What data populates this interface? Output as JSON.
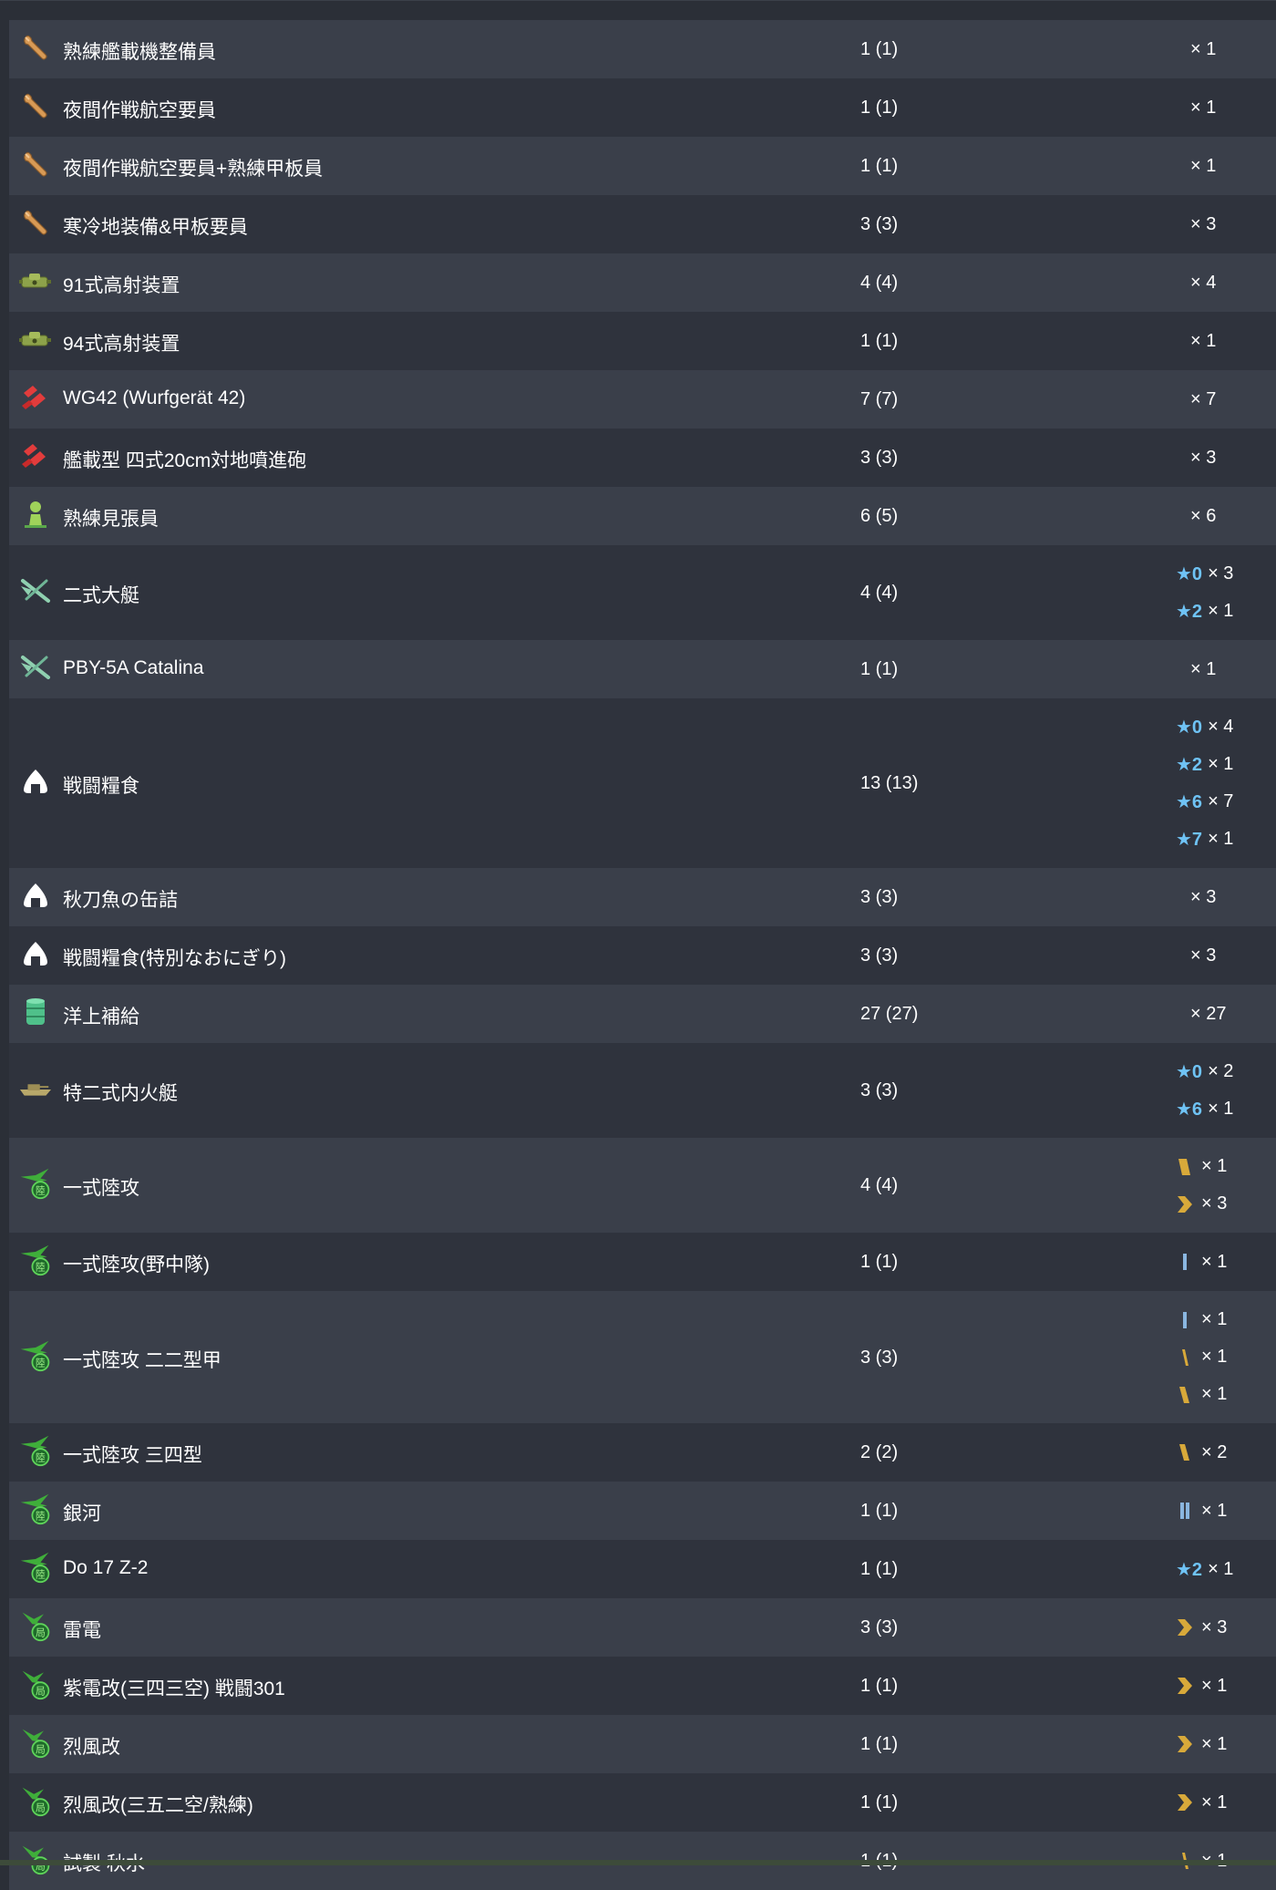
{
  "colors": {
    "star": "#6fc3f5",
    "row_a": "#3a3f4a",
    "row_b": "#2f333d"
  },
  "rows": [
    {
      "icon": "wrench-icon",
      "name": "熟練艦載機整備員",
      "count": "1 (1)",
      "levels": [
        {
          "kind": "plain",
          "mult": "× 1"
        }
      ]
    },
    {
      "icon": "wrench-icon",
      "name": "夜間作戦航空要員",
      "count": "1 (1)",
      "levels": [
        {
          "kind": "plain",
          "mult": "× 1"
        }
      ]
    },
    {
      "icon": "wrench-icon",
      "name": "夜間作戦航空要員+熟練甲板員",
      "count": "1 (1)",
      "levels": [
        {
          "kind": "plain",
          "mult": "× 1"
        }
      ]
    },
    {
      "icon": "wrench-icon",
      "name": "寒冷地装備&甲板要員",
      "count": "3 (3)",
      "levels": [
        {
          "kind": "plain",
          "mult": "× 3"
        }
      ]
    },
    {
      "icon": "aa-fire-director-icon",
      "name": "91式高射装置",
      "count": "4 (4)",
      "levels": [
        {
          "kind": "plain",
          "mult": "× 4"
        }
      ]
    },
    {
      "icon": "aa-fire-director-icon",
      "name": "94式高射装置",
      "count": "1 (1)",
      "levels": [
        {
          "kind": "plain",
          "mult": "× 1"
        }
      ]
    },
    {
      "icon": "rocket-icon",
      "name": "WG42 (Wurfgerät 42)",
      "count": "7 (7)",
      "levels": [
        {
          "kind": "plain",
          "mult": "× 7"
        }
      ]
    },
    {
      "icon": "rocket-icon",
      "name": "艦載型 四式20cm対地噴進砲",
      "count": "3 (3)",
      "levels": [
        {
          "kind": "plain",
          "mult": "× 3"
        }
      ]
    },
    {
      "icon": "lookout-icon",
      "name": "熟練見張員",
      "count": "6 (5)",
      "levels": [
        {
          "kind": "plain",
          "mult": "× 6"
        }
      ]
    },
    {
      "icon": "flying-boat-icon",
      "name": "二式大艇",
      "count": "4 (4)",
      "levels": [
        {
          "kind": "star",
          "value": "★0",
          "mult": "× 3"
        },
        {
          "kind": "star",
          "value": "★2",
          "mult": "× 1"
        }
      ]
    },
    {
      "icon": "flying-boat-icon",
      "name": "PBY-5A Catalina",
      "count": "1 (1)",
      "levels": [
        {
          "kind": "plain",
          "mult": "× 1"
        }
      ]
    },
    {
      "icon": "ration-icon",
      "name": "戦闘糧食",
      "count": "13 (13)",
      "levels": [
        {
          "kind": "star",
          "value": "★0",
          "mult": "× 4"
        },
        {
          "kind": "star",
          "value": "★2",
          "mult": "× 1"
        },
        {
          "kind": "star",
          "value": "★6",
          "mult": "× 7"
        },
        {
          "kind": "star",
          "value": "★7",
          "mult": "× 1"
        }
      ]
    },
    {
      "icon": "ration-icon",
      "name": "秋刀魚の缶詰",
      "count": "3 (3)",
      "levels": [
        {
          "kind": "plain",
          "mult": "× 3"
        }
      ]
    },
    {
      "icon": "ration-icon",
      "name": "戦闘糧食(特別なおにぎり)",
      "count": "3 (3)",
      "levels": [
        {
          "kind": "plain",
          "mult": "× 3"
        }
      ]
    },
    {
      "icon": "drum-icon",
      "name": "洋上補給",
      "count": "27 (27)",
      "levels": [
        {
          "kind": "plain",
          "mult": "× 27"
        }
      ]
    },
    {
      "icon": "landing-craft-icon",
      "name": "特二式内火艇",
      "count": "3 (3)",
      "levels": [
        {
          "kind": "star",
          "value": "★0",
          "mult": "× 2"
        },
        {
          "kind": "star",
          "value": "★6",
          "mult": "× 1"
        }
      ]
    },
    {
      "icon": "land-attacker-icon",
      "name": "一式陸攻",
      "count": "4 (4)",
      "levels": [
        {
          "kind": "prof",
          "value": "prof-yellow-bar",
          "mult": "× 1"
        },
        {
          "kind": "prof",
          "value": "prof-chevron",
          "mult": "× 3"
        }
      ]
    },
    {
      "icon": "land-attacker-icon",
      "name": "一式陸攻(野中隊)",
      "count": "1 (1)",
      "levels": [
        {
          "kind": "prof",
          "value": "prof-blue-1",
          "mult": "× 1"
        }
      ]
    },
    {
      "icon": "land-attacker-icon",
      "name": "一式陸攻 二二型甲",
      "count": "3 (3)",
      "levels": [
        {
          "kind": "prof",
          "value": "prof-blue-1",
          "mult": "× 1"
        },
        {
          "kind": "prof",
          "value": "prof-yellow-1",
          "mult": "× 1"
        },
        {
          "kind": "prof",
          "value": "prof-yellow-2",
          "mult": "× 1"
        }
      ]
    },
    {
      "icon": "land-attacker-icon",
      "name": "一式陸攻 三四型",
      "count": "2 (2)",
      "levels": [
        {
          "kind": "prof",
          "value": "prof-yellow-2",
          "mult": "× 2"
        }
      ]
    },
    {
      "icon": "land-attacker-icon",
      "name": "銀河",
      "count": "1 (1)",
      "levels": [
        {
          "kind": "prof",
          "value": "prof-blue-2",
          "mult": "× 1"
        }
      ]
    },
    {
      "icon": "land-attacker-icon",
      "name": "Do 17 Z-2",
      "count": "1 (1)",
      "levels": [
        {
          "kind": "star",
          "value": "★2",
          "mult": "× 1"
        }
      ]
    },
    {
      "icon": "interceptor-icon",
      "name": "雷電",
      "count": "3 (3)",
      "levels": [
        {
          "kind": "prof",
          "value": "prof-chevron",
          "mult": "× 3"
        }
      ]
    },
    {
      "icon": "interceptor-icon",
      "name": "紫電改(三四三空) 戦闘301",
      "count": "1 (1)",
      "levels": [
        {
          "kind": "prof",
          "value": "prof-chevron",
          "mult": "× 1"
        }
      ]
    },
    {
      "icon": "interceptor-icon",
      "name": "烈風改",
      "count": "1 (1)",
      "levels": [
        {
          "kind": "prof",
          "value": "prof-chevron",
          "mult": "× 1"
        }
      ]
    },
    {
      "icon": "interceptor-icon",
      "name": "烈風改(三五二空/熟練)",
      "count": "1 (1)",
      "levels": [
        {
          "kind": "prof",
          "value": "prof-chevron",
          "mult": "× 1"
        }
      ]
    },
    {
      "icon": "interceptor-icon",
      "name": "試製 秋水",
      "count": "1 (1)",
      "levels": [
        {
          "kind": "prof",
          "value": "prof-yellow-1",
          "mult": "× 1"
        }
      ]
    }
  ]
}
